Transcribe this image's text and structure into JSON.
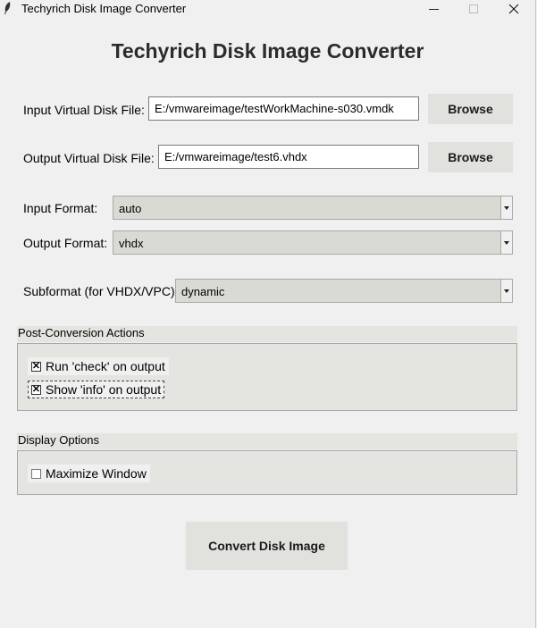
{
  "window": {
    "title": "Techyrich Disk Image Converter",
    "icon": "feather-icon",
    "controls": [
      "minimize-icon",
      "maximize-icon",
      "close-icon"
    ]
  },
  "heading": "Techyrich Disk Image Converter",
  "input_file": {
    "label": "Input Virtual Disk File:",
    "value": "E:/vmwareimage/testWorkMachine-s030.vmdk",
    "browse_label": "Browse"
  },
  "output_file": {
    "label": "Output Virtual Disk File:",
    "value": "E:/vmwareimage/test6.vhdx",
    "browse_label": "Browse"
  },
  "input_format": {
    "label": "Input Format:",
    "value": "auto"
  },
  "output_format": {
    "label": "Output Format:",
    "value": "vhdx"
  },
  "subformat": {
    "label": "Subformat (for VHDX/VPC):",
    "value": "dynamic"
  },
  "post_conversion": {
    "title": "Post-Conversion Actions",
    "options": [
      {
        "label": "Run 'check' on output",
        "checked": true
      },
      {
        "label": "Show 'info' on output",
        "checked": true
      }
    ]
  },
  "display_options": {
    "title": "Display Options",
    "options": [
      {
        "label": "Maximize Window",
        "checked": false
      }
    ]
  },
  "convert_label": "Convert Disk Image",
  "colors": {
    "window_bg": "#f0f0f0",
    "button_bg": "#e1e1dd",
    "group_bg": "#e4e4e0",
    "heading": "#2b2b2b"
  }
}
